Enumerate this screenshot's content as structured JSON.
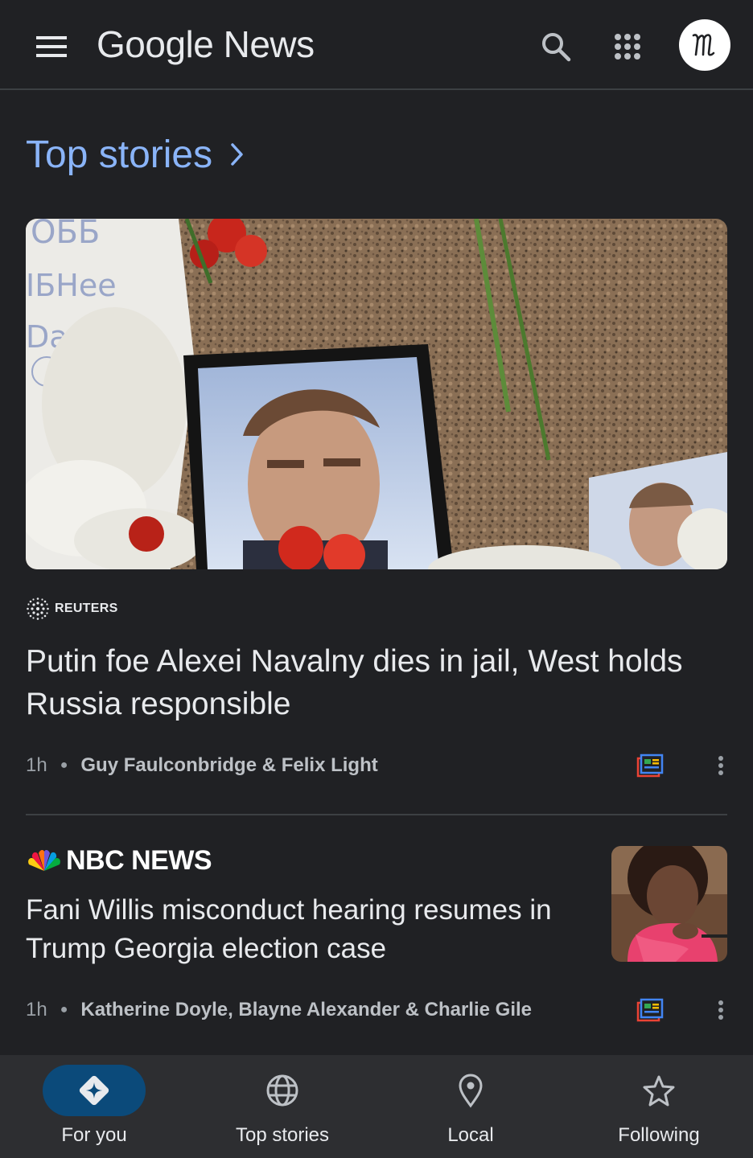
{
  "header": {
    "logo_text": "Google News",
    "menu_icon": "menu-icon",
    "search_icon": "search-icon",
    "apps_icon": "apps-grid-icon",
    "avatar_initials": "M"
  },
  "section": {
    "title": "Top stories",
    "chevron_icon": "chevron-right-icon",
    "accent_color": "#8ab4f8"
  },
  "stories": [
    {
      "source": "REUTERS",
      "headline": "Putin foe Alexei Navalny dies in jail, West holds Russia responsible",
      "age": "1h",
      "byline": "Guy Faulconbridge & Felix Light",
      "image": "hero-photo",
      "coverage_icon": "full-coverage-icon",
      "more_icon": "more-vert-icon"
    },
    {
      "source": "NBC NEWS",
      "headline": "Fani Willis misconduct hearing resumes in Trump Georgia election case",
      "age": "1h",
      "byline": "Katherine Doyle, Blayne Alexander & Charlie Gile",
      "image": "thumbnail-photo",
      "coverage_icon": "full-coverage-icon",
      "more_icon": "more-vert-icon"
    }
  ],
  "bottom_nav": [
    {
      "label": "For you",
      "icon": "for-you-icon",
      "active": true
    },
    {
      "label": "Top stories",
      "icon": "globe-icon",
      "active": false
    },
    {
      "label": "Local",
      "icon": "location-pin-icon",
      "active": false
    },
    {
      "label": "Following",
      "icon": "star-icon",
      "active": false
    }
  ],
  "colors": {
    "background": "#202124",
    "text": "#e8eaed",
    "secondary_text": "#9aa0a6",
    "nav_background": "#2d2e31",
    "active_pill": "#0b4a7a"
  }
}
